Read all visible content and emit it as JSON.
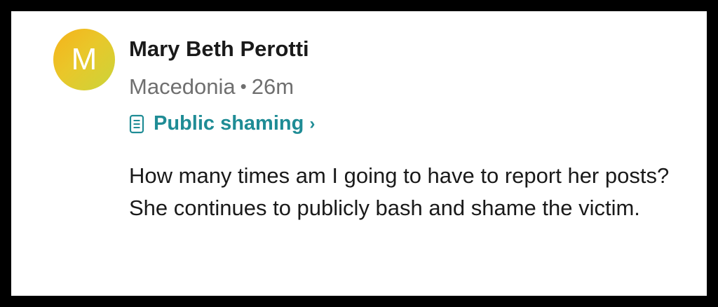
{
  "post": {
    "avatar_letter": "M",
    "author": "Mary Beth Perotti",
    "location": "Macedonia",
    "separator": "•",
    "time": "26m",
    "category": {
      "icon": "document-icon",
      "label": "Public shaming",
      "chevron": "›"
    },
    "body": {
      "line1": "How many times am I going to have to report her posts?",
      "line2": "She continues to publicly bash and shame the victim."
    }
  },
  "colors": {
    "accent": "#1f8c95",
    "avatar_gradient_start": "#f6b21a",
    "avatar_gradient_end": "#cbd43a",
    "meta_text": "#6f6f6f",
    "body_text": "#1a1a1a",
    "frame_border": "#000000"
  }
}
